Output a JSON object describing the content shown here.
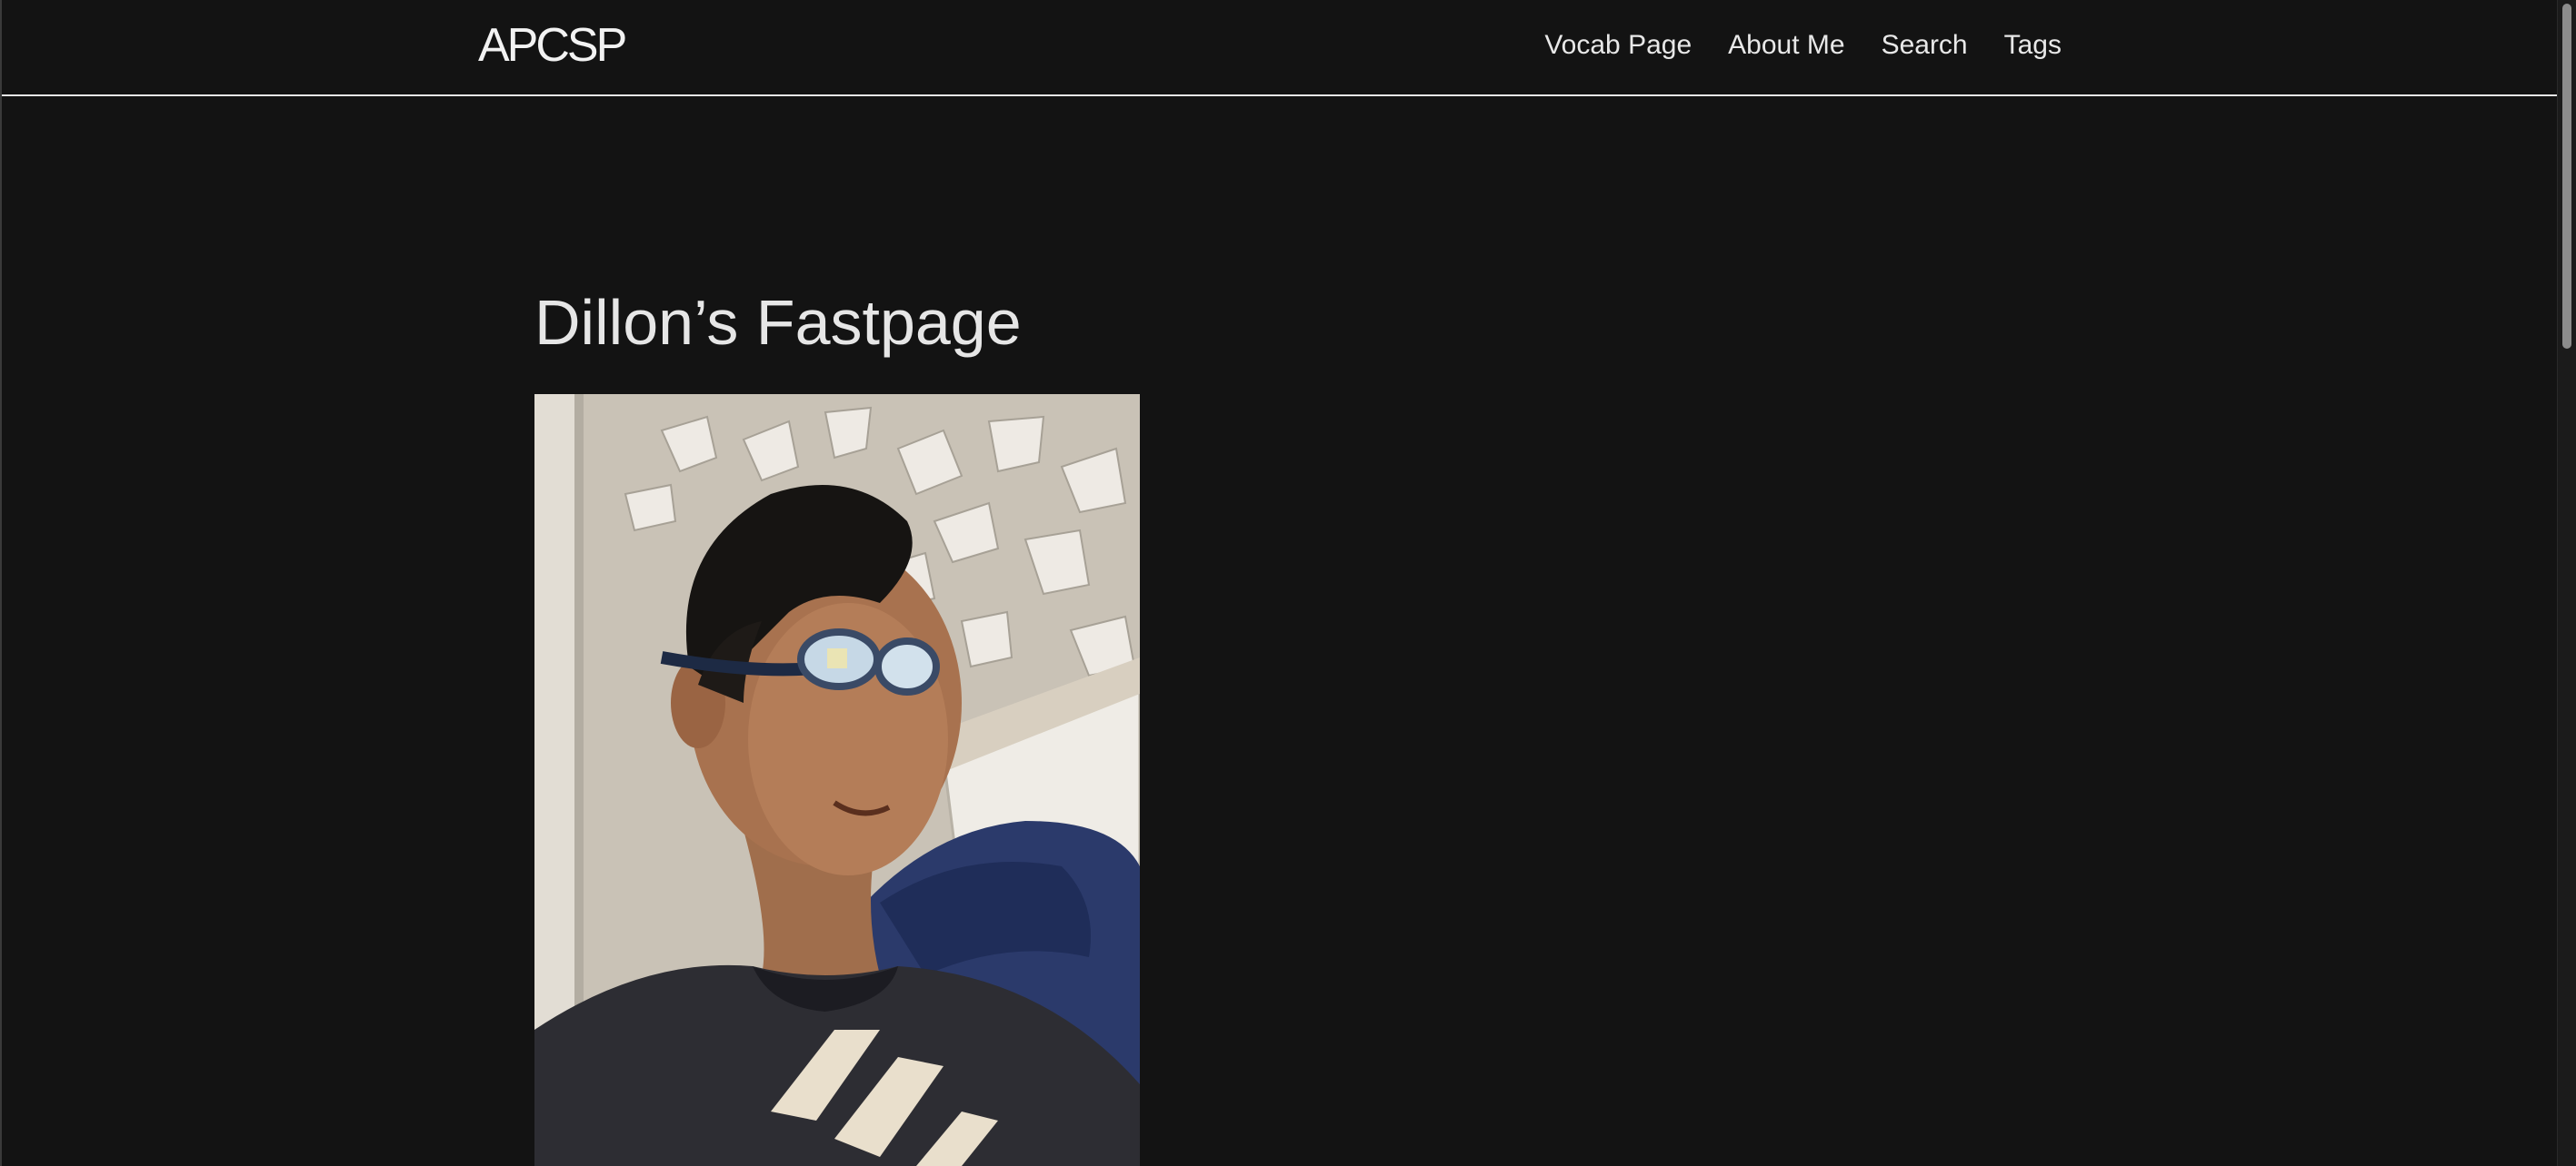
{
  "header": {
    "site_title": "APCSP",
    "nav": [
      {
        "label": "Vocab Page"
      },
      {
        "label": "About Me"
      },
      {
        "label": "Search"
      },
      {
        "label": "Tags"
      }
    ]
  },
  "main": {
    "title": "Dillon’s Fastpage",
    "photo": {
      "subject": "portrait photo of a person wearing glasses pushed up on the forehead and a dark t-shirt"
    }
  }
}
